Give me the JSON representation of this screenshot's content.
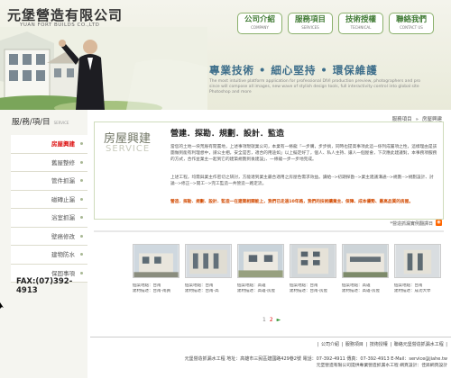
{
  "header": {
    "logo_zh": "元堡營造有限公司",
    "logo_en": "YUAN FORT BUILDS CO.,LTD",
    "slogan": "專業技術 • 細心堅持 • 環保維護",
    "desc": "The most intuitive platform application for professional DIVI production preview, photographers and pro since will compose all images, new wave of stylish design tools, full interactivity control into global site Photoshop and more"
  },
  "nav": [
    {
      "zh": "公司介紹",
      "en": "COMPANY"
    },
    {
      "zh": "服務項目",
      "en": "SERVICES"
    },
    {
      "zh": "技術授權",
      "en": "TECHNICAL"
    },
    {
      "zh": "聯絡我們",
      "en": "CONTACT US"
    }
  ],
  "sidebar": {
    "title": "服/務/項/目",
    "title_en": "SERVICE",
    "items": [
      "房屋興建",
      "舊屋整修",
      "管件抓漏",
      "磁磚止漏",
      "浴室抓漏",
      "壁癌修改",
      "建物防水",
      "保固事項"
    ],
    "fax": "FAX:(07)392-4913"
  },
  "breadcrumb": {
    "home": "服務項目",
    "sep": "»",
    "current": "房屋興建"
  },
  "service": {
    "title_zh": "房屋興建",
    "title_en": "SERVICE",
    "heading": "營建．探勘．規劃．設計．監造",
    "p1": "當您的土地一块荒廢有閒置地，上述事項現就業公司，本業有一條龍『一步購，步步搞，同時也提高事項此這一係列成屬項之性，這樣理由是該團做到能有利理想中，請公主相，安全是否，適合的用途如」以上擬定好了，個人、私人主持、讓人一個屋會，下次應此建議對，本事務項服務的方式，合作並業主一起到它的建築規劃到後建設」、一條龍一步一步地完成。",
    "p2": "上述工程，均需與業主作密切之研討，方能達到業主最合適用之房屋色需求效益。讀給-->初期探勘-->業主建議溝通-->規劃-->規劃設計、討論-->修正-->開工-->完工監造一共營造一路定流。",
    "p3": "營造．探勘．規劃．設計．監造一在建築相關能上，我們已走過10年路，我們的技術讓業主、保障、成本優勢、最高品質的房屋。"
  },
  "cases_link": "*營造抓漏實例翻譯日",
  "cases": [
    {
      "t1": "個案地點：台南",
      "t2": "建材描述：台南-南員"
    },
    {
      "t1": "個案地點：台南",
      "t2": "建材描述：台南-高"
    },
    {
      "t1": "個案地點：高雄",
      "t2": "建材描述：高雄-房屋"
    },
    {
      "t1": "個案地點：台南",
      "t2": "建材描述：台南-房屋"
    },
    {
      "t1": "個案地點：高雄",
      "t2": "建材描述：高雄-房屋"
    },
    {
      "t1": "個案地點：台南",
      "t2": "建材描述：成功大學"
    }
  ],
  "pager": {
    "pages": [
      "1",
      "2"
    ],
    "next": "►"
  },
  "footer": {
    "links": [
      "公司介紹",
      "服務項目",
      "技術授權",
      "聯絡元堡營造抓漏水工程"
    ],
    "address": "元堡營造抓漏水工程 地址：高雄市三民區建國路429巷2號 電話：07-392-4911 傳真：07-392-4913 E-Mail：service@jiahe.tw",
    "copyright": "元堡營造有限公司提供專業營造抓漏水工程 網頁設計：佳昇網頁設計",
    "copyright2": "網頁設計：佳昇網頁設計"
  },
  "colors": {
    "accent_green": "#3f7a33",
    "active_red": "#d11",
    "notice_orange": "#d24a00"
  }
}
